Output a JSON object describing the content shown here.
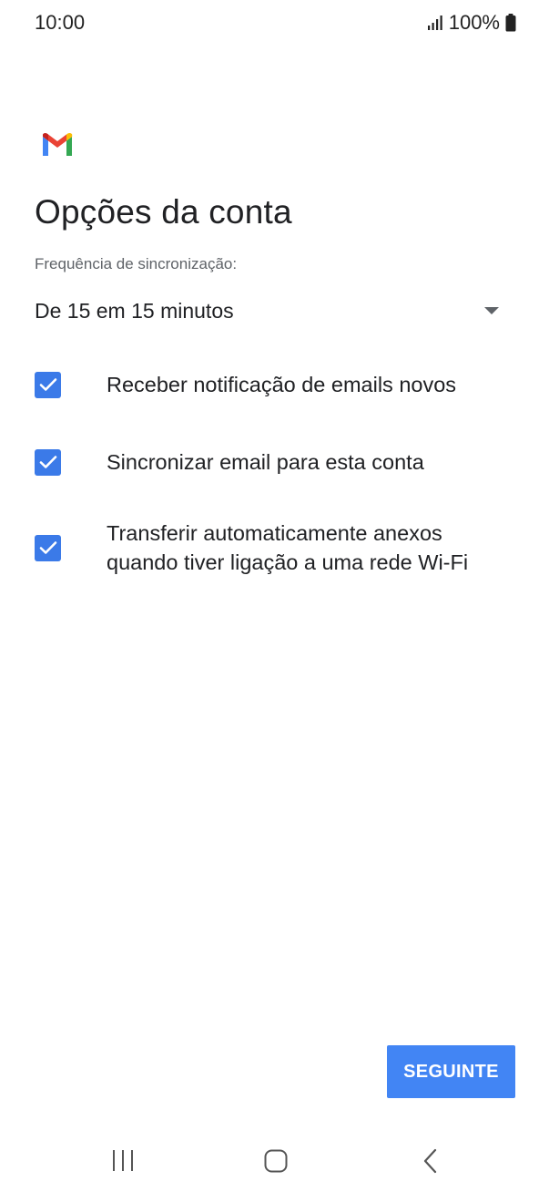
{
  "status_bar": {
    "time": "10:00",
    "battery_percent": "100%",
    "signal_icon": "signal-bars-icon",
    "battery_icon": "battery-full-icon"
  },
  "header": {
    "logo_icon": "gmail-logo-icon",
    "title": "Opções da conta"
  },
  "sync": {
    "label": "Frequência de sincronização:",
    "selected": "De 15 em 15 minutos",
    "dropdown_icon": "dropdown-arrow-icon"
  },
  "options": [
    {
      "label": "Receber notificação de emails novos",
      "checked": true
    },
    {
      "label": "Sincronizar email para esta conta",
      "checked": true
    },
    {
      "label": "Transferir automaticamente anexos quando tiver ligação a uma rede Wi-Fi",
      "checked": true
    }
  ],
  "footer": {
    "next_label": "SEGUINTE"
  },
  "nav_bar": {
    "recents_icon": "recents-icon",
    "home_icon": "home-icon",
    "back_icon": "back-icon"
  },
  "colors": {
    "accent": "#4285f4",
    "checkbox": "#3b7ae8",
    "text_primary": "#202124",
    "text_secondary": "#5f6368"
  }
}
